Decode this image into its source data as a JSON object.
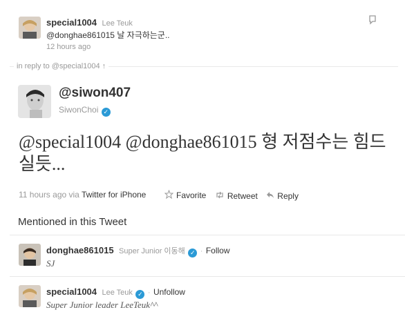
{
  "top_tweet": {
    "username": "special1004",
    "fullname": "Lee Teuk",
    "text": "@donghae861015 날 자극하는군..",
    "time": "12 hours ago"
  },
  "reply_to": {
    "label": "in reply to @special1004 ↑"
  },
  "main_tweet": {
    "username": "@siwon407",
    "fullname": "SiwonChoi",
    "text": "@special1004 @donghae861015 형 저점수는 힘드실듯...",
    "time": "11 hours ago",
    "via_label": "via",
    "source": "Twitter for iPhone",
    "actions": {
      "favorite": "Favorite",
      "retweet": "Retweet",
      "reply": "Reply"
    }
  },
  "mentioned": {
    "title": "Mentioned in this Tweet",
    "users": [
      {
        "username": "donghae861015",
        "fullname": "Super Junior 이동해",
        "follow_label": "Follow",
        "bio": "SJ"
      },
      {
        "username": "special1004",
        "fullname": "Lee Teuk",
        "follow_label": "Unfollow",
        "bio": "Super Junior leader LeeTeuk^^"
      }
    ]
  },
  "colors": {
    "verified": "#2b9ad6",
    "divider": "#e8e8e8",
    "muted": "#999999",
    "text": "#333333"
  },
  "icons": [
    "avatar",
    "flag-icon",
    "star-icon",
    "retweet-icon",
    "reply-icon",
    "verified-icon",
    "follow-icon"
  ]
}
